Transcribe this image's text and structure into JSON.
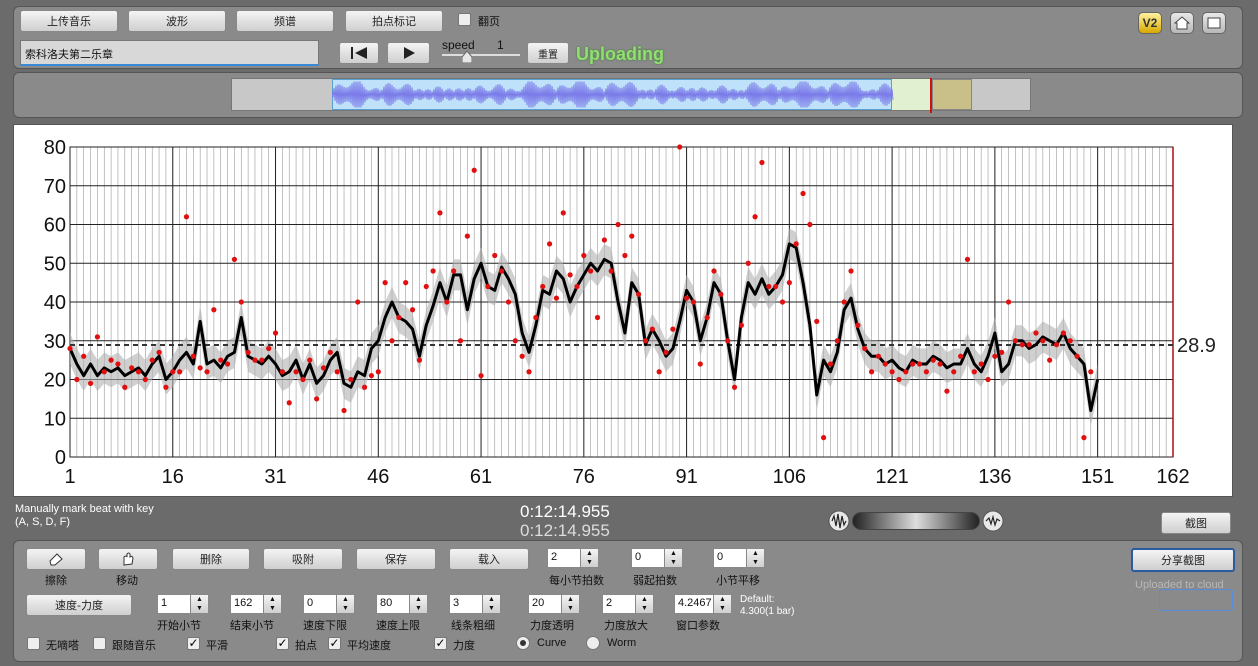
{
  "toolbar": {
    "upload_music": "上传音乐",
    "waveform": "波形",
    "spectrum": "频谱",
    "tap_mark": "拍点标记",
    "flip_page": "翻页",
    "title_value": "索科洛夫第二乐章",
    "speed_label": "speed",
    "speed_value": "1",
    "reset": "重置",
    "status": "Uploading",
    "v2": "V2"
  },
  "info": {
    "hint1": "Manually mark beat with key",
    "hint2": "(A, S, D, F)",
    "time1": "0:12:14.955",
    "time2": "0:12:14.955",
    "screenshot": "截图"
  },
  "controls": {
    "erase": "擦除",
    "move": "移动",
    "delete": "删除",
    "snap": "吸附",
    "save": "保存",
    "load": "载入",
    "beats_per_bar": "每小节拍数",
    "beats_per_bar_value": "2",
    "pickup": "弱起拍数",
    "pickup_value": "0",
    "bar_shift": "小节平移",
    "bar_shift_value": "0",
    "share": "分享截图",
    "uploaded": "Uploaded to cloud",
    "mode": "速度-力度",
    "start_bar": "开始小节",
    "start_bar_value": "1",
    "end_bar": "结束小节",
    "end_bar_value": "162",
    "tempo_low": "速度下限",
    "tempo_low_value": "0",
    "tempo_high": "速度上限",
    "tempo_high_value": "80",
    "line_width": "线条粗细",
    "line_width_value": "3",
    "dyn_alpha": "力度透明",
    "dyn_alpha_value": "20",
    "dyn_zoom": "力度放大",
    "dyn_zoom_value": "2",
    "window": "窗口参数",
    "window_value": "4.2467",
    "default1": "Default:",
    "default2": "4.300(1 bar)",
    "metronome": "无嘀嗒",
    "follow": "跟随音乐",
    "smooth": "平滑",
    "beats": "拍点",
    "avg_tempo": "平均速度",
    "dynamics": "力度",
    "curve": "Curve",
    "worm": "Worm"
  },
  "colors": {
    "points": "#e01010",
    "curve": "#000000",
    "band": "#b0b0b0",
    "status": "#90e070"
  },
  "chart_data": {
    "type": "line",
    "xlim": [
      1,
      162
    ],
    "ylim": [
      0,
      80
    ],
    "xticks": [
      1,
      16,
      31,
      46,
      61,
      76,
      91,
      106,
      121,
      136,
      151,
      162
    ],
    "yticks": [
      0,
      10,
      20,
      30,
      40,
      50,
      60,
      70,
      80
    ],
    "average_line": 28.9,
    "average_label": "28.9",
    "grid": true,
    "smoothed_curve": {
      "x": [
        1,
        2,
        3,
        4,
        5,
        6,
        7,
        8,
        9,
        10,
        11,
        12,
        13,
        14,
        15,
        16,
        17,
        18,
        19,
        20,
        21,
        22,
        23,
        24,
        25,
        26,
        27,
        28,
        29,
        30,
        31,
        32,
        33,
        34,
        35,
        36,
        37,
        38,
        39,
        40,
        41,
        42,
        43,
        44,
        45,
        46,
        47,
        48,
        49,
        50,
        51,
        52,
        53,
        54,
        55,
        56,
        57,
        58,
        59,
        60,
        61,
        62,
        63,
        64,
        65,
        66,
        67,
        68,
        69,
        70,
        71,
        72,
        73,
        74,
        75,
        76,
        77,
        78,
        79,
        80,
        81,
        82,
        83,
        84,
        85,
        86,
        87,
        88,
        89,
        90,
        91,
        92,
        93,
        94,
        95,
        96,
        97,
        98,
        99,
        100,
        101,
        102,
        103,
        104,
        105,
        106,
        107,
        108,
        109,
        110,
        111,
        112,
        113,
        114,
        115,
        116,
        117,
        118,
        119,
        120,
        121,
        122,
        123,
        124,
        125,
        126,
        127,
        128,
        129,
        130,
        131,
        132,
        133,
        134,
        135,
        136,
        137,
        138,
        139,
        140,
        141,
        142,
        143,
        144,
        145,
        146,
        147,
        148,
        149,
        150,
        151,
        152,
        153,
        154,
        155,
        156,
        157,
        158,
        159,
        160,
        161,
        162
      ],
      "y": [
        28,
        24,
        21,
        24,
        21,
        23,
        22,
        23,
        21,
        22,
        23,
        21,
        24,
        26,
        20,
        22,
        25,
        27,
        24,
        35,
        24,
        25,
        23,
        26,
        27,
        36,
        26,
        25,
        24,
        26,
        24,
        21,
        22,
        25,
        20,
        24,
        19,
        21,
        25,
        27,
        19,
        18,
        22,
        21,
        28,
        30,
        36,
        40,
        36,
        35,
        33,
        26,
        34,
        39,
        45,
        40,
        47,
        47,
        38,
        46,
        50,
        44,
        43,
        49,
        46,
        42,
        32,
        27,
        34,
        43,
        42,
        48,
        46,
        40,
        44,
        47,
        50,
        48,
        51,
        50,
        40,
        32,
        45,
        42,
        29,
        33,
        30,
        26,
        28,
        35,
        43,
        40,
        30,
        36,
        45,
        42,
        30,
        20,
        36,
        45,
        42,
        46,
        42,
        44,
        47,
        55,
        54,
        45,
        34,
        16,
        25,
        22,
        27,
        38,
        41,
        33,
        28,
        26,
        26,
        24,
        25,
        23,
        22,
        25,
        24,
        24,
        26,
        25,
        23,
        24,
        24,
        28,
        24,
        22,
        26,
        32,
        22,
        24,
        30,
        30,
        28,
        29,
        31,
        30,
        29,
        32,
        28,
        26,
        24,
        12,
        20
      ],
      "x_offset": 10
    },
    "scatter_points": {
      "x": [
        1,
        2,
        3,
        4,
        5,
        6,
        7,
        8,
        9,
        10,
        11,
        12,
        13,
        14,
        15,
        16,
        17,
        18,
        19,
        20,
        21,
        22,
        23,
        24,
        25,
        26,
        27,
        28,
        29,
        30,
        31,
        32,
        33,
        34,
        35,
        36,
        37,
        38,
        39,
        40,
        41,
        42,
        43,
        44,
        45,
        46,
        47,
        48,
        49,
        50,
        51,
        52,
        53,
        54,
        55,
        56,
        57,
        58,
        59,
        60,
        61,
        62,
        63,
        64,
        65,
        66,
        67,
        68,
        69,
        70,
        71,
        72,
        73,
        74,
        75,
        76,
        77,
        78,
        79,
        80,
        81,
        82,
        83,
        84,
        85,
        86,
        87,
        88,
        89,
        90,
        91,
        92,
        93,
        94,
        95,
        96,
        97,
        98,
        99,
        100,
        101,
        102,
        103,
        104,
        105,
        106,
        107,
        108,
        109,
        110,
        111,
        112,
        113,
        114,
        115,
        116,
        117,
        118,
        119,
        120,
        121,
        122,
        123,
        124,
        125,
        126,
        127,
        128,
        129,
        130,
        131,
        132,
        133,
        134,
        135,
        136,
        137,
        138,
        139,
        140,
        141,
        142,
        143,
        144,
        145,
        146,
        147,
        148,
        149,
        150,
        151,
        152,
        153,
        154,
        155,
        156,
        157,
        158,
        159,
        160,
        161,
        162
      ],
      "y": [
        28,
        20,
        26,
        19,
        31,
        22,
        25,
        24,
        18,
        23,
        22,
        20,
        25,
        27,
        18,
        22,
        22,
        62,
        26,
        23,
        22,
        38,
        25,
        24,
        51,
        40,
        27,
        25,
        25,
        28,
        32,
        22,
        14,
        22,
        20,
        25,
        15,
        23,
        27,
        22,
        12,
        20,
        40,
        18,
        21,
        22,
        45,
        30,
        36,
        45,
        38,
        25,
        44,
        48,
        63,
        40,
        48,
        30,
        57,
        74,
        21,
        44,
        52,
        48,
        40,
        30,
        26,
        22,
        36,
        44,
        55,
        41,
        63,
        47,
        44,
        52,
        48,
        36,
        56,
        48,
        60,
        52,
        57,
        42,
        30,
        33,
        22,
        27,
        33,
        80,
        41,
        40,
        24,
        36,
        48,
        42,
        30,
        18,
        34,
        50,
        62,
        76,
        44,
        44,
        40,
        45,
        55,
        68,
        60,
        35,
        5,
        24,
        30,
        40,
        48,
        34,
        28,
        22,
        26,
        24,
        22,
        20,
        22,
        24,
        24,
        22,
        25,
        24,
        17,
        22,
        26,
        51,
        22,
        24,
        20,
        26,
        27,
        40,
        30,
        29,
        29,
        32,
        30,
        25,
        29,
        32,
        30,
        26,
        5,
        22
      ]
    }
  }
}
